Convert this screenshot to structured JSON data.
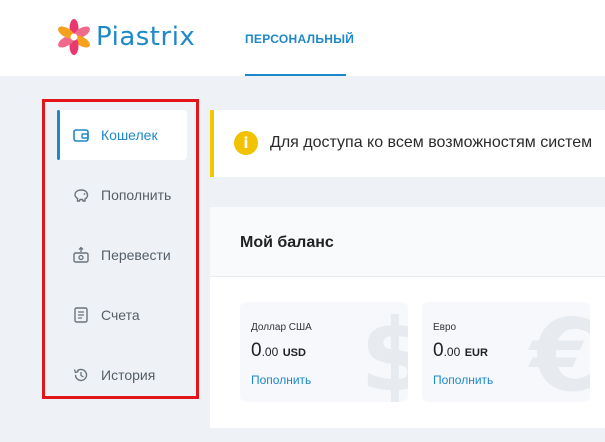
{
  "header": {
    "logo_text": "Piastrix",
    "nav": {
      "active_tab": "ПЕРСОНАЛЬНЫЙ"
    }
  },
  "sidebar": {
    "items": [
      {
        "label": "Кошелек",
        "icon": "wallet-icon",
        "active": true
      },
      {
        "label": "Пополнить",
        "icon": "piggy-bank-icon",
        "active": false
      },
      {
        "label": "Перевести",
        "icon": "transfer-icon",
        "active": false
      },
      {
        "label": "Счета",
        "icon": "invoice-icon",
        "active": false
      },
      {
        "label": "История",
        "icon": "history-icon",
        "active": false
      }
    ]
  },
  "alert": {
    "icon": "info-icon",
    "icon_glyph": "i",
    "text": "Для доступа ко всем возможностям систем"
  },
  "balance": {
    "title": "Мой баланс",
    "cards": [
      {
        "name": "Доллар США",
        "amount_int": "0",
        "amount_dec": ".00",
        "currency": "USD",
        "bg_symbol": "$",
        "link": "Пополнить"
      },
      {
        "name": "Евро",
        "amount_int": "0",
        "amount_dec": ".00",
        "currency": "EUR",
        "bg_symbol": "€",
        "link": "Пополнить"
      }
    ]
  },
  "colors": {
    "accent": "#1e88c9",
    "alert": "#f7c600",
    "highlight_border": "#e2161a",
    "logo_petals": [
      "#e8386d",
      "#f4a11d",
      "#f06a8c"
    ]
  }
}
